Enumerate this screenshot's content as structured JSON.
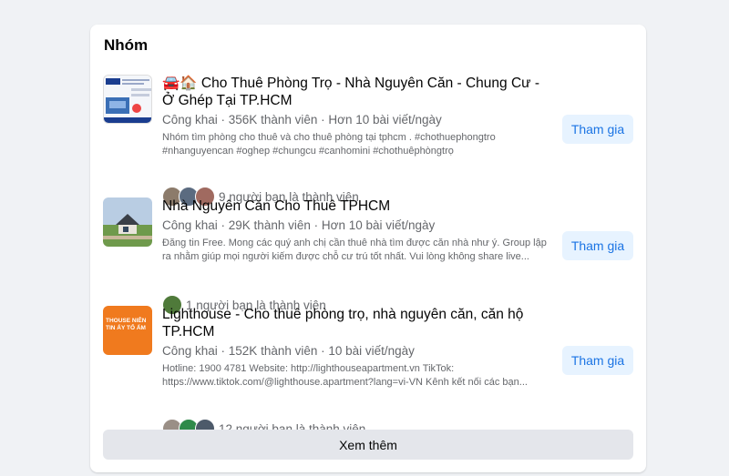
{
  "section_title": "Nhóm",
  "groups": [
    {
      "name": "🚘🏠 Cho Thuê Phòng Trọ - Nhà Nguyên Căn - Chung Cư - Ở Ghép Tại TP.HCM",
      "meta": "Công khai · 356K thành viên · Hơn 10 bài viết/ngày",
      "description": "Nhóm tìm phòng cho thuê và cho thuê phòng tại tphcm . #chothuephongtro #nhanguyencan #oghep #chungcu #canhomini #chothuêphòngtrọ",
      "friends_text": "9 người bạn là thành viên",
      "join_label": "Tham gia"
    },
    {
      "name": "Nhà Nguyên Căn Cho Thuê TPHCM",
      "meta": "Công khai · 29K thành viên · Hơn 10 bài viết/ngày",
      "description": "Đăng tin Free. Mong các quý anh chị cần thuê nhà tìm được căn nhà như ý. Group lập ra nhằm giúp mọi người kiếm được chỗ cư trú tốt nhất. Vui lòng không share live...",
      "friends_text": "1 người bạn là thành viên",
      "join_label": "Tham gia"
    },
    {
      "name": "Lighthouse - Cho thuê phòng trọ, nhà nguyên căn, căn hộ TP.HCM",
      "meta": "Công khai · 152K thành viên · 10 bài viết/ngày",
      "description": "Hotline: 1900 4781 Website: http://lighthouseapartment.vn TikTok: https://www.tiktok.com/@lighthouse.apartment?lang=vi-VN Kênh kết nối các bạn...",
      "friends_text": "12 người bạn là thành viên",
      "join_label": "Tham gia",
      "thumb_text": "THOUSE NIÊN TIN ẤY TỔ ẤM"
    }
  ],
  "see_more_label": "Xem thêm"
}
